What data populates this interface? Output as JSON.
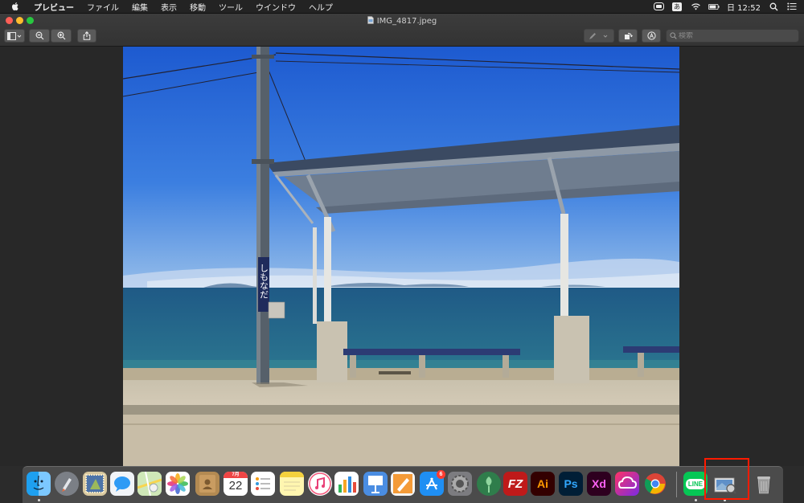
{
  "menubar": {
    "app_name": "プレビュー",
    "items": [
      "ファイル",
      "編集",
      "表示",
      "移動",
      "ツール",
      "ウインドウ",
      "ヘルプ"
    ],
    "input_mode": "あ",
    "clock": "日 12:52"
  },
  "window": {
    "title": "IMG_4817.jpeg",
    "search_placeholder": "検索"
  },
  "photo": {
    "sign_text": "しもなだ"
  },
  "dock": {
    "calendar_month": "7月",
    "calendar_day": "22",
    "app_store_badge": "6",
    "filezilla_label": "FZ",
    "illustrator_label": "Ai",
    "photoshop_label": "Ps",
    "xd_label": "Xd",
    "line_label": "LINE"
  },
  "colors": {
    "highlight": "#ff1a00",
    "menubar_bg": "#232323",
    "window_bg": "#282828",
    "dock_bg": "#4e4e4e"
  }
}
